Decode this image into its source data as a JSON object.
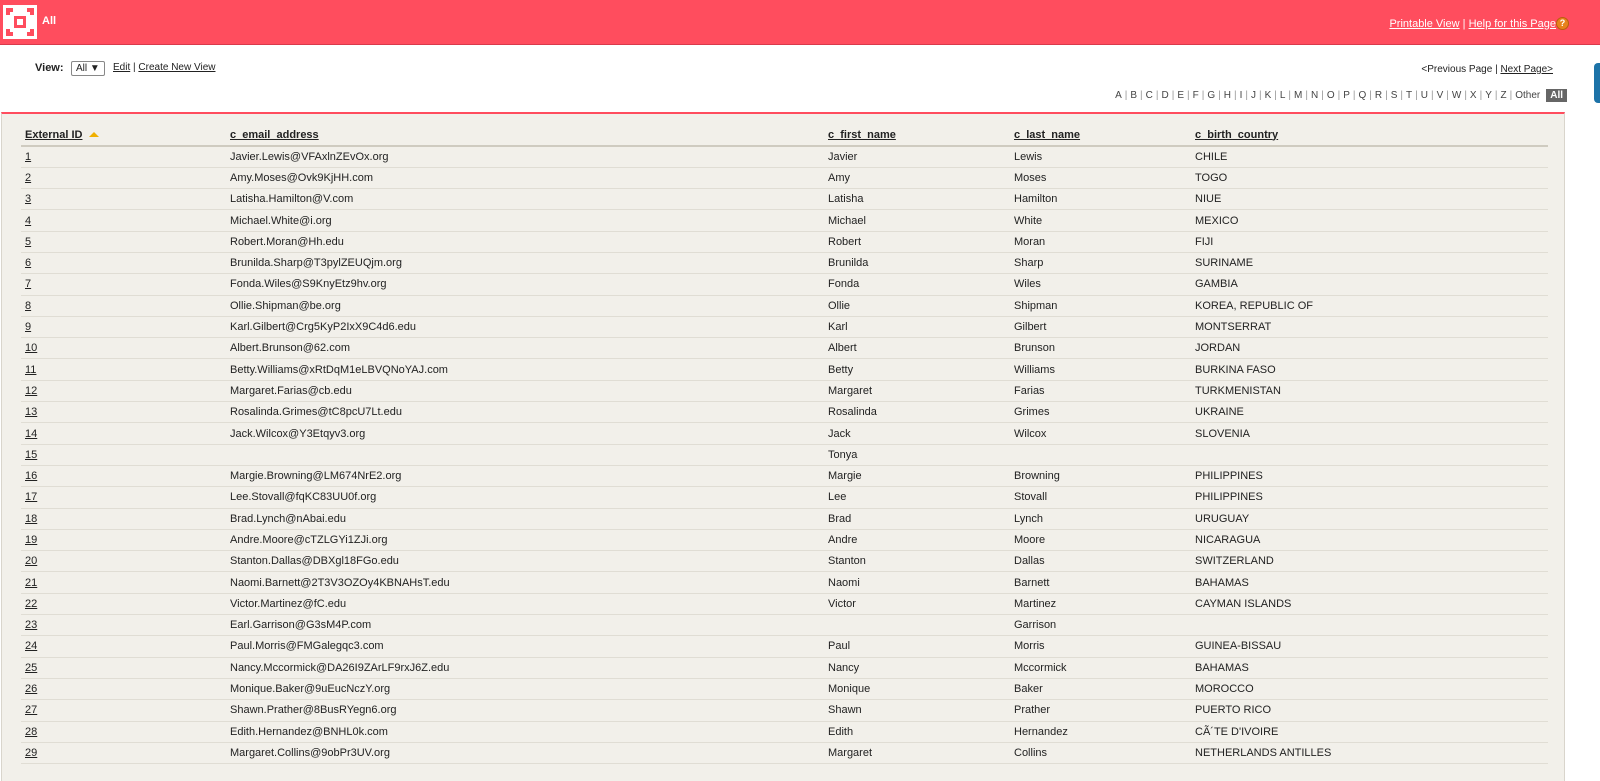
{
  "header": {
    "title": "All",
    "printable_view": "Printable View",
    "separator": "|",
    "help": "Help for this Page",
    "help_icon": "?"
  },
  "viewbar": {
    "view_label": "View:",
    "selected_view": "All ▼",
    "edit": "Edit",
    "separator": "|",
    "create_new_view": "Create New View",
    "prev_page": "<Previous Page",
    "next_page": "Next Page>",
    "alphabet": [
      "A",
      "B",
      "C",
      "D",
      "E",
      "F",
      "G",
      "H",
      "I",
      "J",
      "K",
      "L",
      "M",
      "N",
      "O",
      "P",
      "Q",
      "R",
      "S",
      "T",
      "U",
      "V",
      "W",
      "X",
      "Y",
      "Z",
      "Other"
    ],
    "all": "All"
  },
  "table": {
    "columns": [
      "External ID",
      "c_email_address",
      "c_first_name",
      "c_last_name",
      "c_birth_country"
    ],
    "rows": [
      [
        "1",
        "Javier.Lewis@VFAxlnZEvOx.org",
        "Javier",
        "Lewis",
        "CHILE"
      ],
      [
        "2",
        "Amy.Moses@Ovk9KjHH.com",
        "Amy",
        "Moses",
        "TOGO"
      ],
      [
        "3",
        "Latisha.Hamilton@V.com",
        "Latisha",
        "Hamilton",
        "NIUE"
      ],
      [
        "4",
        "Michael.White@i.org",
        "Michael",
        "White",
        "MEXICO"
      ],
      [
        "5",
        "Robert.Moran@Hh.edu",
        "Robert",
        "Moran",
        "FIJI"
      ],
      [
        "6",
        "Brunilda.Sharp@T3pylZEUQjm.org",
        "Brunilda",
        "Sharp",
        "SURINAME"
      ],
      [
        "7",
        "Fonda.Wiles@S9KnyEtz9hv.org",
        "Fonda",
        "Wiles",
        "GAMBIA"
      ],
      [
        "8",
        "Ollie.Shipman@be.org",
        "Ollie",
        "Shipman",
        "KOREA, REPUBLIC OF"
      ],
      [
        "9",
        "Karl.Gilbert@Crg5KyP2IxX9C4d6.edu",
        "Karl",
        "Gilbert",
        "MONTSERRAT"
      ],
      [
        "10",
        "Albert.Brunson@62.com",
        "Albert",
        "Brunson",
        "JORDAN"
      ],
      [
        "11",
        "Betty.Williams@xRtDqM1eLBVQNoYAJ.com",
        "Betty",
        "Williams",
        "BURKINA FASO"
      ],
      [
        "12",
        "Margaret.Farias@cb.edu",
        "Margaret",
        "Farias",
        "TURKMENISTAN"
      ],
      [
        "13",
        "Rosalinda.Grimes@tC8pcU7Lt.edu",
        "Rosalinda",
        "Grimes",
        "UKRAINE"
      ],
      [
        "14",
        "Jack.Wilcox@Y3Etqyv3.org",
        "Jack",
        "Wilcox",
        "SLOVENIA"
      ],
      [
        "15",
        "",
        "Tonya",
        "",
        ""
      ],
      [
        "16",
        "Margie.Browning@LM674NrE2.org",
        "Margie",
        "Browning",
        "PHILIPPINES"
      ],
      [
        "17",
        "Lee.Stovall@fqKC83UU0f.org",
        "Lee",
        "Stovall",
        "PHILIPPINES"
      ],
      [
        "18",
        "Brad.Lynch@nAbai.edu",
        "Brad",
        "Lynch",
        "URUGUAY"
      ],
      [
        "19",
        "Andre.Moore@cTZLGYi1ZJi.org",
        "Andre",
        "Moore",
        "NICARAGUA"
      ],
      [
        "20",
        "Stanton.Dallas@DBXgl18FGo.edu",
        "Stanton",
        "Dallas",
        "SWITZERLAND"
      ],
      [
        "21",
        "Naomi.Barnett@2T3V3OZOy4KBNAHsT.edu",
        "Naomi",
        "Barnett",
        "BAHAMAS"
      ],
      [
        "22",
        "Victor.Martinez@fC.edu",
        "Victor",
        "Martinez",
        "CAYMAN ISLANDS"
      ],
      [
        "23",
        "Earl.Garrison@G3sM4P.com",
        "",
        "Garrison",
        ""
      ],
      [
        "24",
        "Paul.Morris@FMGalegqc3.com",
        "Paul",
        "Morris",
        "GUINEA-BISSAU"
      ],
      [
        "25",
        "Nancy.Mccormick@DA26I9ZArLF9rxJ6Z.edu",
        "Nancy",
        "Mccormick",
        "BAHAMAS"
      ],
      [
        "26",
        "Monique.Baker@9uEucNczY.org",
        "Monique",
        "Baker",
        "MOROCCO"
      ],
      [
        "27",
        "Shawn.Prather@8BusRYegn6.org",
        "Shawn",
        "Prather",
        "PUERTO RICO"
      ],
      [
        "28",
        "Edith.Hernandez@BNHL0k.com",
        "Edith",
        "Hernandez",
        "CÃ´TE D'IVOIRE"
      ],
      [
        "29",
        "Margaret.Collins@9obPr3UV.org",
        "Margaret",
        "Collins",
        "NETHERLANDS ANTILLES"
      ]
    ]
  },
  "colors": {
    "header_bg": "#ff4d5e",
    "content_bg": "#f2f0ea",
    "sort_arrow": "#f0b000"
  }
}
